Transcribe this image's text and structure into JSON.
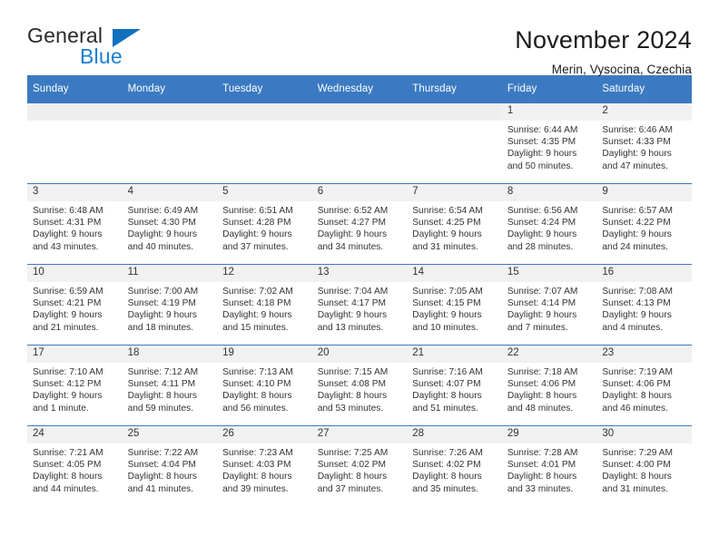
{
  "logo": {
    "word_dark": "General",
    "word_blue": "Blue",
    "triangle_color": "#1271bf",
    "blue_color": "#1b7fd4"
  },
  "header": {
    "title": "November 2024",
    "subtitle": "Merin, Vysocina, Czechia"
  },
  "theme": {
    "header_blue": "#3b7ac2",
    "daynum_band": "#f1f1f1",
    "text": "#333333"
  },
  "calendar": {
    "weekdays": [
      "Sunday",
      "Monday",
      "Tuesday",
      "Wednesday",
      "Thursday",
      "Friday",
      "Saturday"
    ],
    "labels": {
      "sunrise": "Sunrise:",
      "sunset": "Sunset:",
      "daylight": "Daylight:"
    },
    "weeks": [
      [
        {
          "day": "",
          "empty": true
        },
        {
          "day": "",
          "empty": true
        },
        {
          "day": "",
          "empty": true
        },
        {
          "day": "",
          "empty": true
        },
        {
          "day": "",
          "empty": true
        },
        {
          "day": "1",
          "sunrise": "Sunrise: 6:44 AM",
          "sunset": "Sunset: 4:35 PM",
          "daylight1": "Daylight: 9 hours",
          "daylight2": "and 50 minutes."
        },
        {
          "day": "2",
          "sunrise": "Sunrise: 6:46 AM",
          "sunset": "Sunset: 4:33 PM",
          "daylight1": "Daylight: 9 hours",
          "daylight2": "and 47 minutes."
        }
      ],
      [
        {
          "day": "3",
          "sunrise": "Sunrise: 6:48 AM",
          "sunset": "Sunset: 4:31 PM",
          "daylight1": "Daylight: 9 hours",
          "daylight2": "and 43 minutes."
        },
        {
          "day": "4",
          "sunrise": "Sunrise: 6:49 AM",
          "sunset": "Sunset: 4:30 PM",
          "daylight1": "Daylight: 9 hours",
          "daylight2": "and 40 minutes."
        },
        {
          "day": "5",
          "sunrise": "Sunrise: 6:51 AM",
          "sunset": "Sunset: 4:28 PM",
          "daylight1": "Daylight: 9 hours",
          "daylight2": "and 37 minutes."
        },
        {
          "day": "6",
          "sunrise": "Sunrise: 6:52 AM",
          "sunset": "Sunset: 4:27 PM",
          "daylight1": "Daylight: 9 hours",
          "daylight2": "and 34 minutes."
        },
        {
          "day": "7",
          "sunrise": "Sunrise: 6:54 AM",
          "sunset": "Sunset: 4:25 PM",
          "daylight1": "Daylight: 9 hours",
          "daylight2": "and 31 minutes."
        },
        {
          "day": "8",
          "sunrise": "Sunrise: 6:56 AM",
          "sunset": "Sunset: 4:24 PM",
          "daylight1": "Daylight: 9 hours",
          "daylight2": "and 28 minutes."
        },
        {
          "day": "9",
          "sunrise": "Sunrise: 6:57 AM",
          "sunset": "Sunset: 4:22 PM",
          "daylight1": "Daylight: 9 hours",
          "daylight2": "and 24 minutes."
        }
      ],
      [
        {
          "day": "10",
          "sunrise": "Sunrise: 6:59 AM",
          "sunset": "Sunset: 4:21 PM",
          "daylight1": "Daylight: 9 hours",
          "daylight2": "and 21 minutes."
        },
        {
          "day": "11",
          "sunrise": "Sunrise: 7:00 AM",
          "sunset": "Sunset: 4:19 PM",
          "daylight1": "Daylight: 9 hours",
          "daylight2": "and 18 minutes."
        },
        {
          "day": "12",
          "sunrise": "Sunrise: 7:02 AM",
          "sunset": "Sunset: 4:18 PM",
          "daylight1": "Daylight: 9 hours",
          "daylight2": "and 15 minutes."
        },
        {
          "day": "13",
          "sunrise": "Sunrise: 7:04 AM",
          "sunset": "Sunset: 4:17 PM",
          "daylight1": "Daylight: 9 hours",
          "daylight2": "and 13 minutes."
        },
        {
          "day": "14",
          "sunrise": "Sunrise: 7:05 AM",
          "sunset": "Sunset: 4:15 PM",
          "daylight1": "Daylight: 9 hours",
          "daylight2": "and 10 minutes."
        },
        {
          "day": "15",
          "sunrise": "Sunrise: 7:07 AM",
          "sunset": "Sunset: 4:14 PM",
          "daylight1": "Daylight: 9 hours",
          "daylight2": "and 7 minutes."
        },
        {
          "day": "16",
          "sunrise": "Sunrise: 7:08 AM",
          "sunset": "Sunset: 4:13 PM",
          "daylight1": "Daylight: 9 hours",
          "daylight2": "and 4 minutes."
        }
      ],
      [
        {
          "day": "17",
          "sunrise": "Sunrise: 7:10 AM",
          "sunset": "Sunset: 4:12 PM",
          "daylight1": "Daylight: 9 hours",
          "daylight2": "and 1 minute."
        },
        {
          "day": "18",
          "sunrise": "Sunrise: 7:12 AM",
          "sunset": "Sunset: 4:11 PM",
          "daylight1": "Daylight: 8 hours",
          "daylight2": "and 59 minutes."
        },
        {
          "day": "19",
          "sunrise": "Sunrise: 7:13 AM",
          "sunset": "Sunset: 4:10 PM",
          "daylight1": "Daylight: 8 hours",
          "daylight2": "and 56 minutes."
        },
        {
          "day": "20",
          "sunrise": "Sunrise: 7:15 AM",
          "sunset": "Sunset: 4:08 PM",
          "daylight1": "Daylight: 8 hours",
          "daylight2": "and 53 minutes."
        },
        {
          "day": "21",
          "sunrise": "Sunrise: 7:16 AM",
          "sunset": "Sunset: 4:07 PM",
          "daylight1": "Daylight: 8 hours",
          "daylight2": "and 51 minutes."
        },
        {
          "day": "22",
          "sunrise": "Sunrise: 7:18 AM",
          "sunset": "Sunset: 4:06 PM",
          "daylight1": "Daylight: 8 hours",
          "daylight2": "and 48 minutes."
        },
        {
          "day": "23",
          "sunrise": "Sunrise: 7:19 AM",
          "sunset": "Sunset: 4:06 PM",
          "daylight1": "Daylight: 8 hours",
          "daylight2": "and 46 minutes."
        }
      ],
      [
        {
          "day": "24",
          "sunrise": "Sunrise: 7:21 AM",
          "sunset": "Sunset: 4:05 PM",
          "daylight1": "Daylight: 8 hours",
          "daylight2": "and 44 minutes."
        },
        {
          "day": "25",
          "sunrise": "Sunrise: 7:22 AM",
          "sunset": "Sunset: 4:04 PM",
          "daylight1": "Daylight: 8 hours",
          "daylight2": "and 41 minutes."
        },
        {
          "day": "26",
          "sunrise": "Sunrise: 7:23 AM",
          "sunset": "Sunset: 4:03 PM",
          "daylight1": "Daylight: 8 hours",
          "daylight2": "and 39 minutes."
        },
        {
          "day": "27",
          "sunrise": "Sunrise: 7:25 AM",
          "sunset": "Sunset: 4:02 PM",
          "daylight1": "Daylight: 8 hours",
          "daylight2": "and 37 minutes."
        },
        {
          "day": "28",
          "sunrise": "Sunrise: 7:26 AM",
          "sunset": "Sunset: 4:02 PM",
          "daylight1": "Daylight: 8 hours",
          "daylight2": "and 35 minutes."
        },
        {
          "day": "29",
          "sunrise": "Sunrise: 7:28 AM",
          "sunset": "Sunset: 4:01 PM",
          "daylight1": "Daylight: 8 hours",
          "daylight2": "and 33 minutes."
        },
        {
          "day": "30",
          "sunrise": "Sunrise: 7:29 AM",
          "sunset": "Sunset: 4:00 PM",
          "daylight1": "Daylight: 8 hours",
          "daylight2": "and 31 minutes."
        }
      ]
    ]
  }
}
